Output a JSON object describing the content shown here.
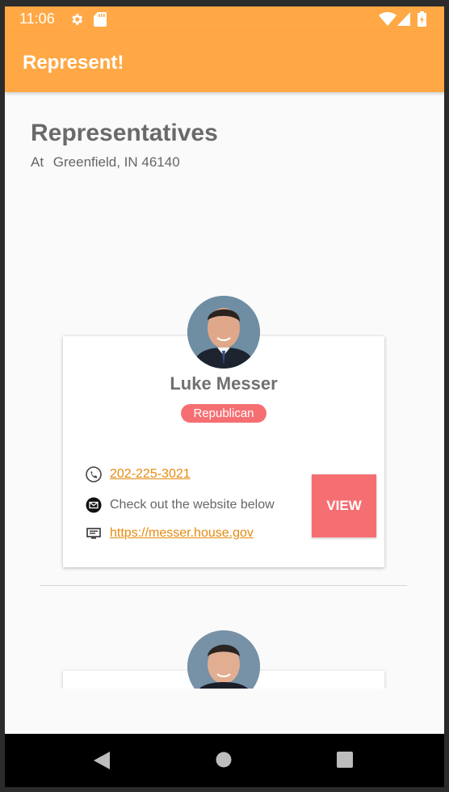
{
  "status_bar": {
    "time": "11:06",
    "icons": [
      "settings-icon",
      "sd-card-icon",
      "wifi-icon",
      "signal-icon",
      "battery-icon"
    ]
  },
  "app_bar": {
    "title": "Represent!"
  },
  "header": {
    "title": "Representatives",
    "location_prefix": "At",
    "location": "Greenfield, IN 46140"
  },
  "representatives": [
    {
      "name": "Luke Messer",
      "party": "Republican",
      "phone": "202-225-3021",
      "email_text": "Check out the website below",
      "website": "https://messer.house.gov",
      "view_label": "VIEW"
    }
  ],
  "nav_bar": {
    "buttons": [
      "back-icon",
      "home-icon",
      "recents-icon"
    ]
  },
  "colors": {
    "accent": "#ffa845",
    "party_badge": "#f56f72",
    "link": "#e58a0e"
  }
}
